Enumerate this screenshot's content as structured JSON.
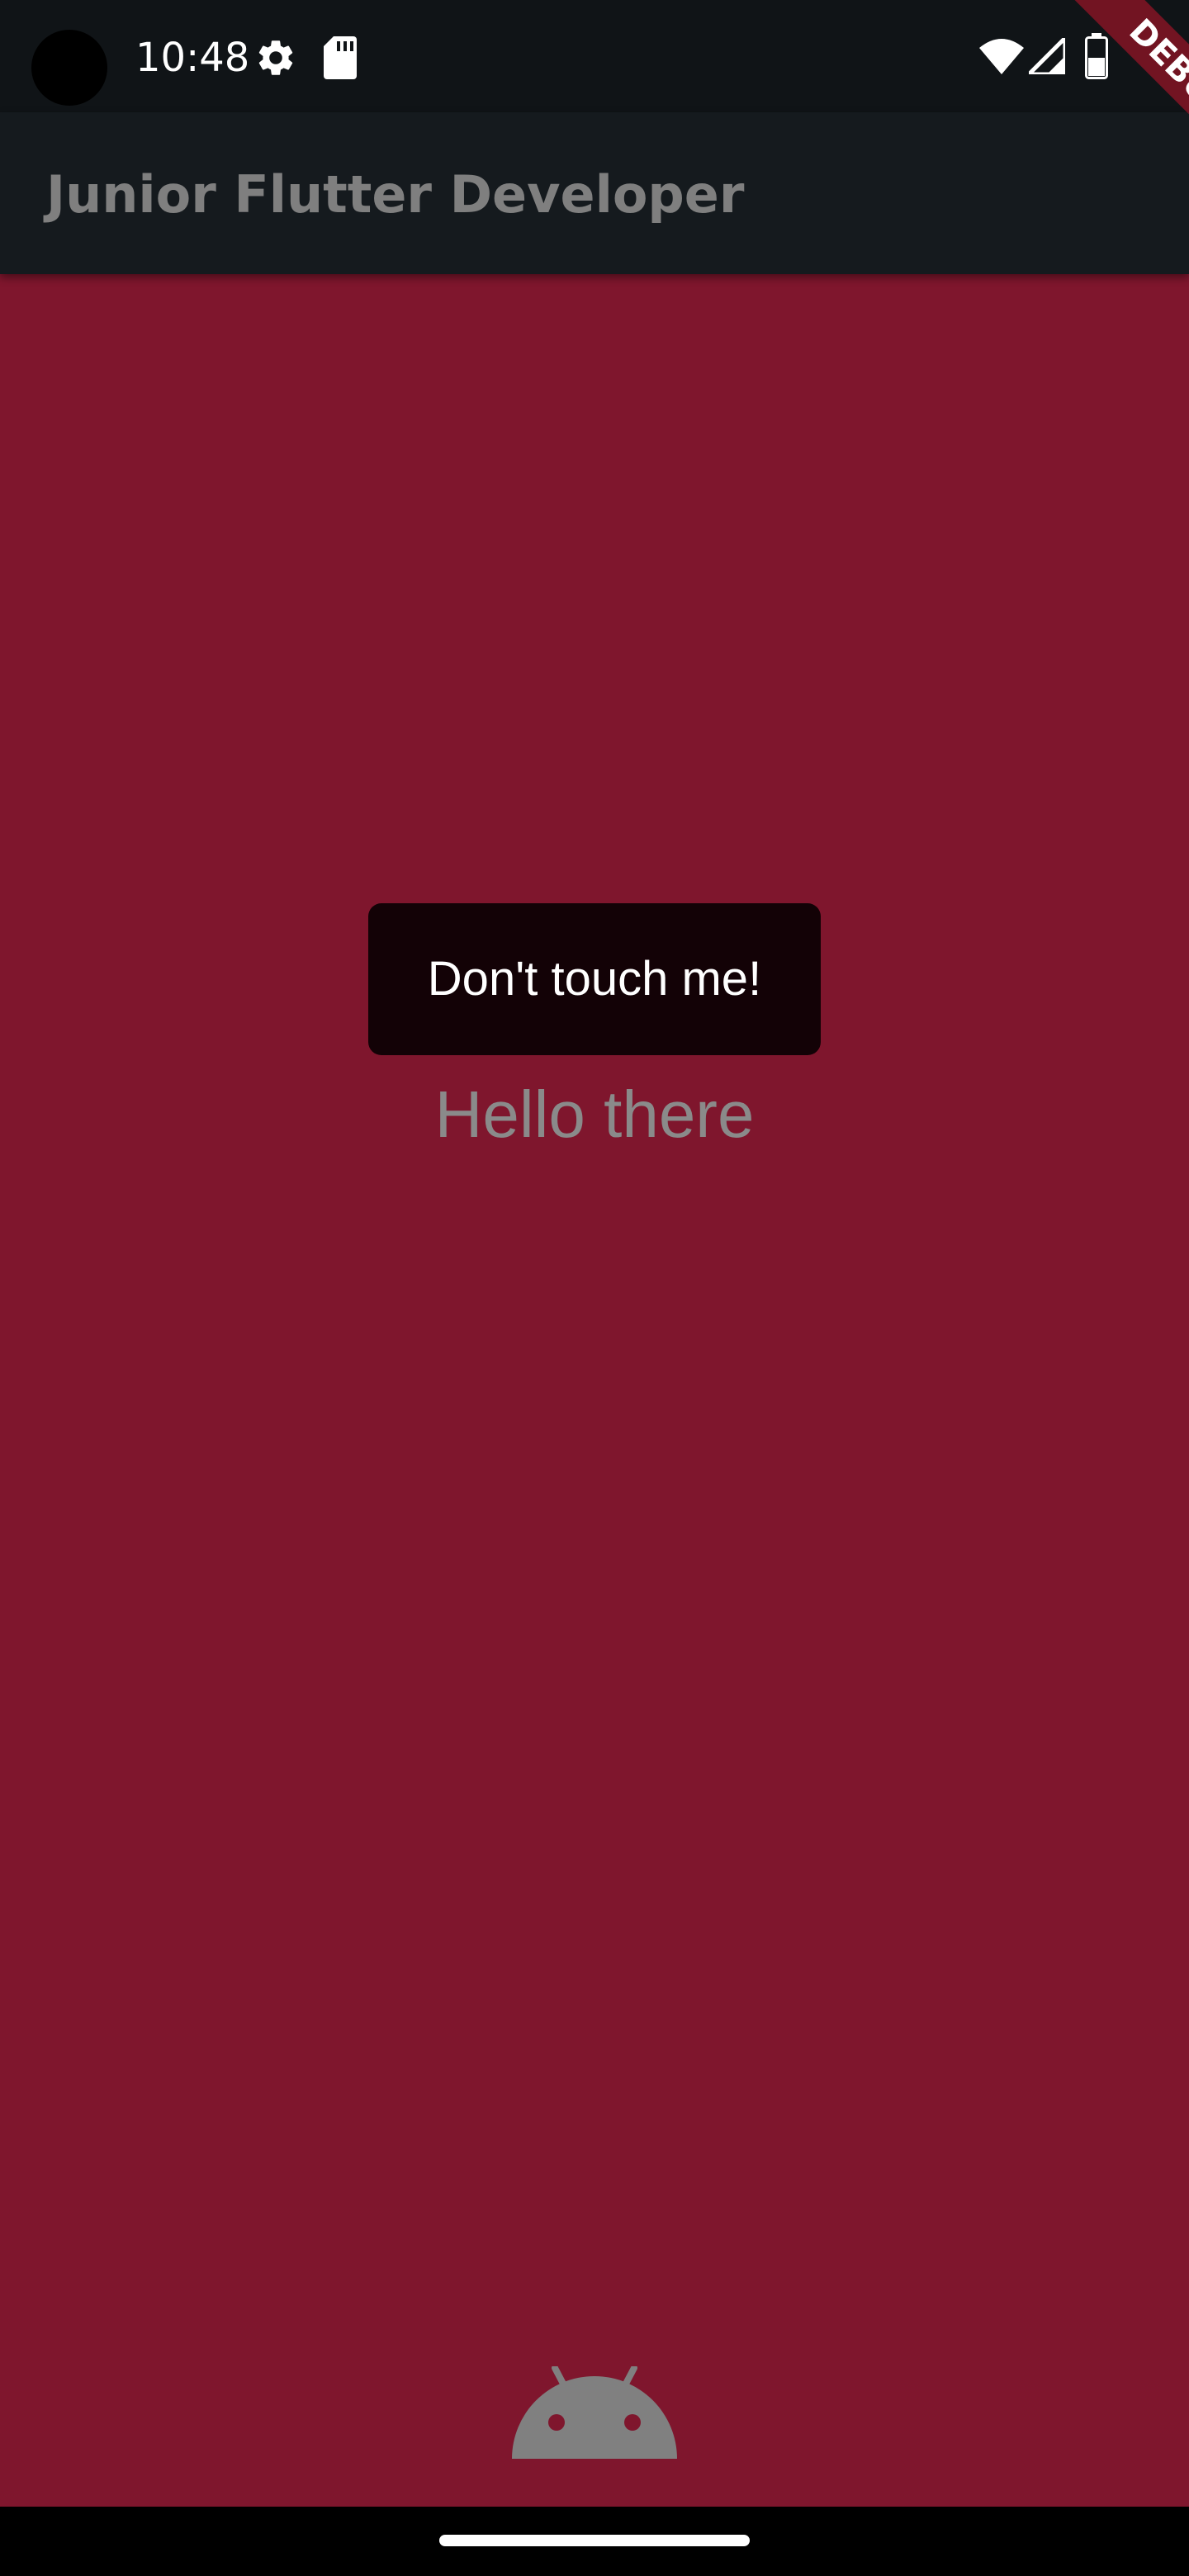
{
  "status_bar": {
    "time": "10:48",
    "icons": [
      "settings-gear-icon",
      "sd-card-icon",
      "wifi-icon",
      "cell-signal-icon",
      "battery-icon"
    ]
  },
  "app_bar": {
    "title": "Junior Flutter Developer",
    "background": "#151a1e"
  },
  "debug_banner": {
    "label": "DEBUG"
  },
  "content": {
    "background": "#7f162d",
    "toast_text": "Don't touch me!",
    "greeting": "Hello there"
  },
  "nav_bar": {
    "icon": "home-indicator"
  }
}
